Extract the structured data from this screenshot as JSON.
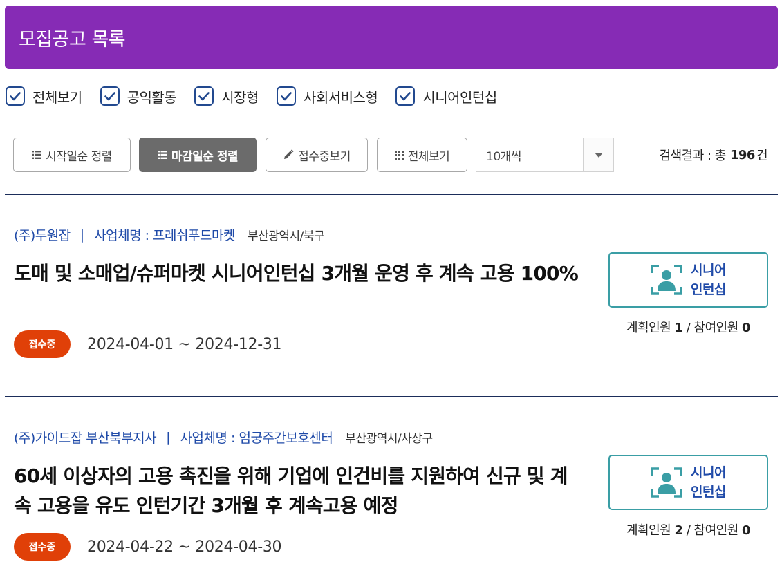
{
  "header": {
    "title": "모집공고 목록"
  },
  "filters": [
    {
      "label": "전체보기",
      "checked": true
    },
    {
      "label": "공익활동",
      "checked": true
    },
    {
      "label": "시장형",
      "checked": true
    },
    {
      "label": "사회서비스형",
      "checked": true
    },
    {
      "label": "시니어인턴십",
      "checked": true
    }
  ],
  "toolbar": {
    "sort_start": "시작일순 정렬",
    "sort_deadline": "마감일순 정렬",
    "view_receiving": "접수중보기",
    "view_all": "전체보기",
    "page_size": "10개씩",
    "result_prefix": "검색결과 : 총",
    "result_count": "196",
    "result_suffix": "건"
  },
  "colors": {
    "header": "#862bb5",
    "badge": "#e04008",
    "accent": "#1f4aa8",
    "tag_border": "#3a9ea5"
  },
  "listings": [
    {
      "company": "(주)두원잡",
      "separator": "|",
      "business": "사업체명 : 프레쉬푸드마켓",
      "region": "부산광역시/북구",
      "title": "도매 및 소매업/슈퍼마켓 시니어인턴십 3개월 운영 후 계속 고용 100%",
      "status": "접수중",
      "period": "2024-04-01 ~ 2024-12-31",
      "tag_line1": "시니어",
      "tag_line2": "인턴십",
      "planned_label": "계획인원",
      "planned": "1",
      "slash": "/",
      "joined_label": "참여인원",
      "joined": "0"
    },
    {
      "company": "(주)가이드잡 부산북부지사",
      "separator": "|",
      "business": "사업체명 : 엄궁주간보호센터",
      "region": "부산광역시/사상구",
      "title": "60세 이상자의 고용 촉진을 위해 기업에 인건비를 지원하여 신규 및 계속 고용을 유도 인턴기간 3개월 후 계속고용 예정",
      "status": "접수중",
      "period": "2024-04-22 ~ 2024-04-30",
      "tag_line1": "시니어",
      "tag_line2": "인턴십",
      "planned_label": "계획인원",
      "planned": "2",
      "slash": "/",
      "joined_label": "참여인원",
      "joined": "0"
    }
  ]
}
